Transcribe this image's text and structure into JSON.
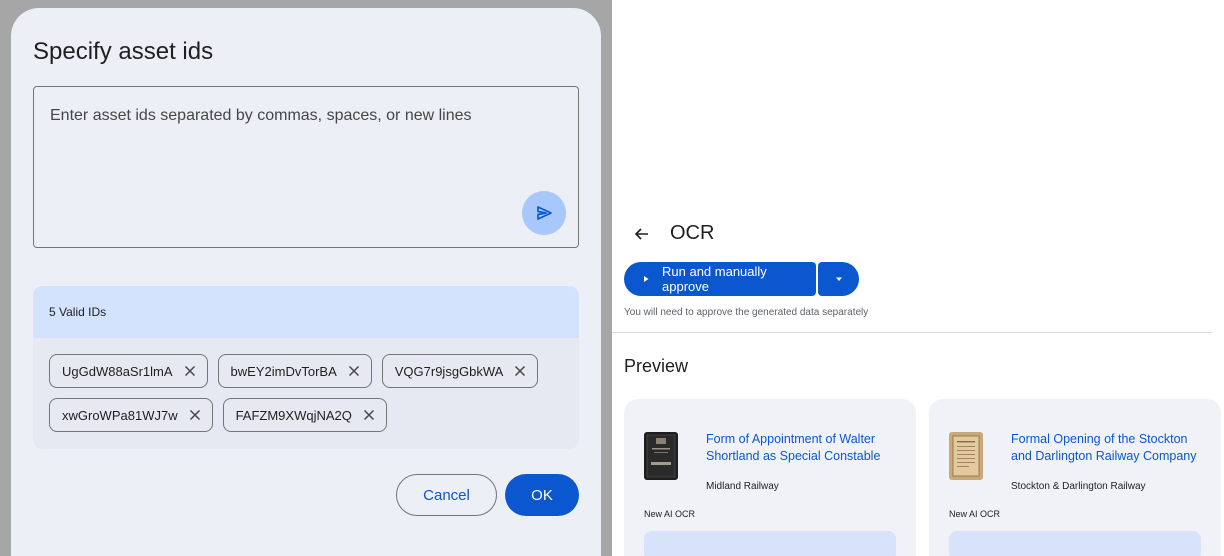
{
  "dialog": {
    "title": "Specify asset ids",
    "input_placeholder": "Enter asset ids separated by commas, spaces, or new lines",
    "send_icon": "send-icon",
    "valid_header": "5 Valid IDs",
    "chips": [
      {
        "id": "UgGdW88aSr1lmA"
      },
      {
        "id": "bwEY2imDvTorBA"
      },
      {
        "id": "VQG7r9jsgGbkWA"
      },
      {
        "id": "xwGroWPa81WJ7w"
      },
      {
        "id": "FAFZM9XWqjNA2Q"
      }
    ],
    "cancel_label": "Cancel",
    "ok_label": "OK"
  },
  "page": {
    "title": "OCR",
    "run_button_label": "Run and manually approve",
    "hint": "You will need to approve the generated data separately",
    "preview_title": "Preview",
    "cards": [
      {
        "title": "Form of Appointment of Walter Shortland as Special Constable",
        "source": "Midland Railway",
        "tag": "New AI OCR"
      },
      {
        "title": "Formal Opening of the Stockton and Darlington Railway Company",
        "source": "Stockton & Darlington Railway",
        "tag": "New AI OCR"
      }
    ]
  },
  "colors": {
    "primary": "#0b57d0",
    "dialog_bg": "#eceff6",
    "valid_header_bg": "#d3e3fd",
    "send_button_bg": "#a8c7fa"
  }
}
